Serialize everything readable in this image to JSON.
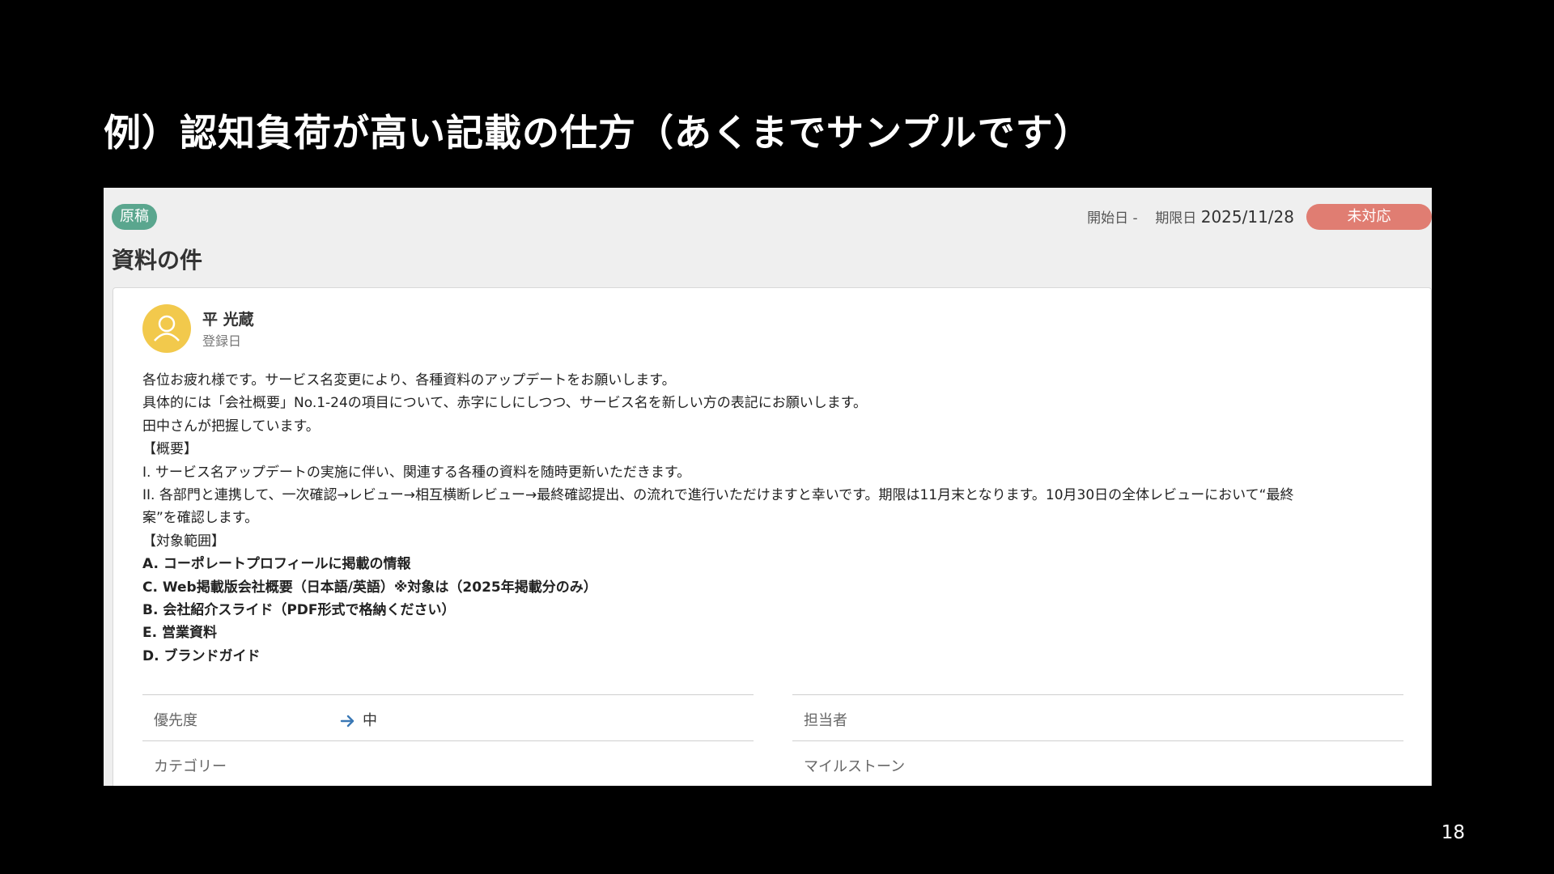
{
  "slide": {
    "title": "例）認知負荷が高い記載の仕方（あくまでサンプルです）",
    "page_number": "18"
  },
  "ticket": {
    "draft_badge": "原稿",
    "start_date_label": "開始日",
    "start_date_value": "-",
    "due_date_label": "期限日",
    "due_date_value": "2025/11/28",
    "status": "未対応",
    "title": "資料の件",
    "colors": {
      "draft_badge": "#5aa68e",
      "status_badge": "#e07d72",
      "avatar": "#f2c94c"
    }
  },
  "comment": {
    "author": "平 光蔵",
    "registered_label": "登録日",
    "lines": [
      "各位お疲れ様です。サービス名変更により、各種資料のアップデートをお願いします。",
      "具体的には「会社概要」No.1-24の項目について、赤字にしにしつつ、サービス名を新しい方の表記にお願いします。",
      "田中さんが把握しています。",
      "【概要】",
      "I. サービス名アップデートの実施に伴い、関連する各種の資料を随時更新いただきます。",
      "II. 各部門と連携して、一次確認→レビュー→相互横断レビュー→最終確認提出、の流れで進行いただけますと幸いです。期限は11月末となります。10月30日の全体レビューにおいて“最終",
      "案”を確認します。",
      "【対象範囲】"
    ],
    "bold_lines": [
      "A. コーポレートプロフィールに掲載の情報",
      "C. Web掲載版会社概要（日本語/英語）※対象は（2025年掲載分のみ）",
      "B. 会社紹介スライド（PDF形式で格納ください）",
      "E. 営業資料",
      "D. ブランドガイド"
    ]
  },
  "fields": {
    "priority_label": "優先度",
    "priority_value": "中",
    "priority_icon": "arrow-right-icon",
    "assignee_label": "担当者",
    "category_label": "カテゴリー",
    "milestone_label": "マイルストーン"
  }
}
